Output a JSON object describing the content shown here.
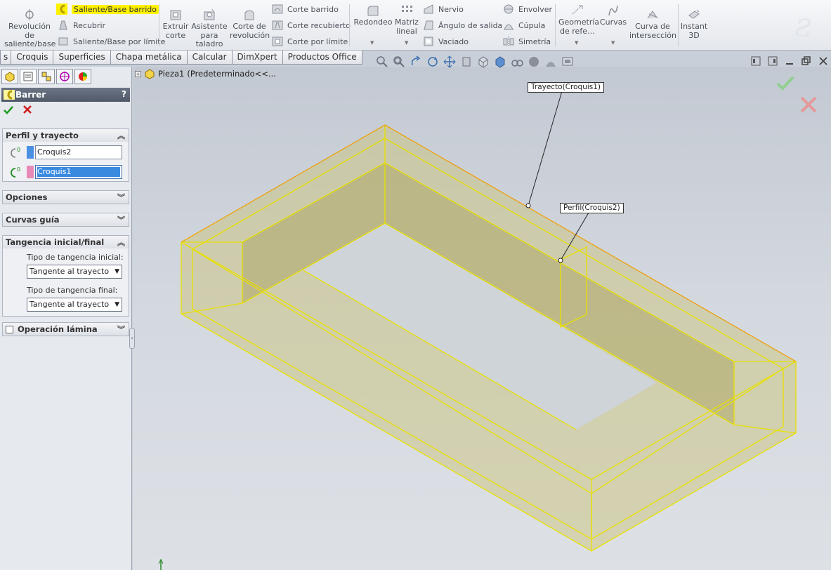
{
  "ribbon": {
    "revolve": "Revolución de saliente/base",
    "sweep": "Saliente/Base barrido",
    "loft": "Recubrir",
    "boundary": "Saliente/Base por límite",
    "extrude_cut": "Extruir corte",
    "hole_wizard": "Asistente para taladro",
    "revolve_cut": "Corte de revolución",
    "swept_cut": "Corte barrido",
    "lofted_cut": "Corte recubierto",
    "boundary_cut": "Corte por límite",
    "fillet": "Redondeo",
    "linear_pattern": "Matriz lineal",
    "rib": "Nervio",
    "draft": "Ángulo de salida",
    "shell": "Vaciado",
    "wrap": "Envolver",
    "dome": "Cúpula",
    "mirror": "Simetría",
    "ref_geometry": "Geometría de refe…",
    "curves": "Curvas",
    "intersection_curve": "Curva de intersección",
    "instant3d": "Instant 3D"
  },
  "tabs": [
    "s",
    "Croquis",
    "Superficies",
    "Chapa metálica",
    "Calcular",
    "DimXpert",
    "Productos Office"
  ],
  "tree": {
    "part": "Pieza1",
    "config": "(Predeterminado<<..."
  },
  "panel": {
    "title": "Barrer",
    "help": "?",
    "groups": {
      "profile_path": "Perfil y trayecto",
      "options": "Opciones",
      "guide_curves": "Curvas guía",
      "tangency": "Tangencia inicial/final",
      "thin": "Operación lámina"
    },
    "profile_value": "Croquis2",
    "path_value": "Croquis1",
    "start_label": "Tipo de tangencia inicial:",
    "start_value": "Tangente al trayecto",
    "end_label": "Tipo de tangencia final:",
    "end_value": "Tangente al trayecto"
  },
  "callouts": {
    "path": "Trayecto(Croquis1)",
    "profile": "Perfil(Croquis2)"
  },
  "colors": {
    "highlight": "#fff200",
    "model_edge": "#e8e000",
    "model_fill": "#c9c070",
    "selected": "#3a8be0"
  }
}
